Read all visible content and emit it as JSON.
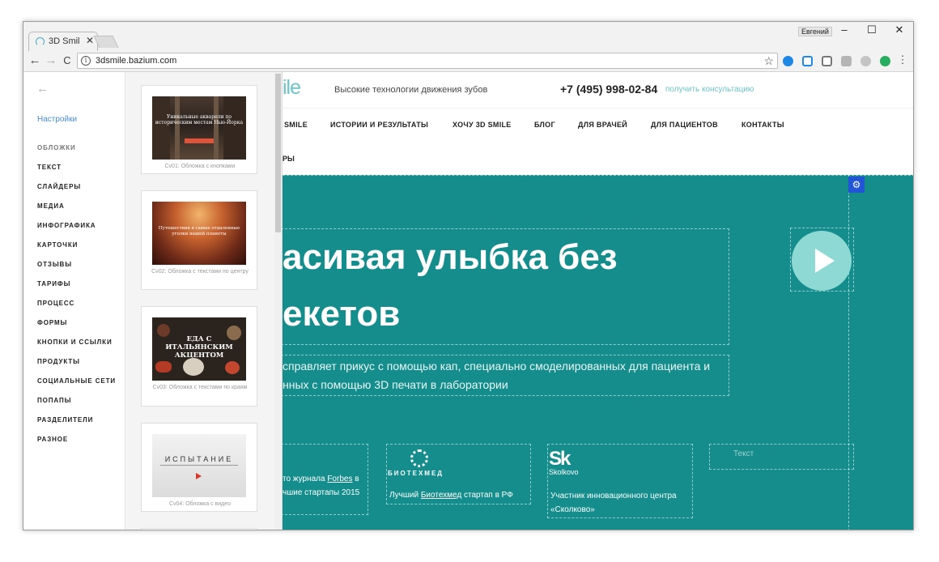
{
  "browser": {
    "tab_title": "3D Smil",
    "tab_close": "✕",
    "user_name": "Евгений",
    "controls": {
      "minimize": "–",
      "maximize": "☐",
      "close": "✕"
    },
    "nav": {
      "back": "←",
      "forward": "→",
      "reload": "C"
    },
    "url": "3dsmile.bazium.com",
    "info_glyph": "i",
    "star_glyph": "☆",
    "menu_glyph": "⋮",
    "extensions": [
      "#1e88e5",
      "#1e88e5",
      "#777777",
      "#9e9e9e",
      "#9e9e9e",
      "#27ae60"
    ]
  },
  "sidebar": {
    "back_arrow": "←",
    "settings": "Настройки",
    "categories": [
      "ОБЛОЖКИ",
      "ТЕКСТ",
      "СЛАЙДЕРЫ",
      "МЕДИА",
      "ИНФОГРАФИКА",
      "КАРТОЧКИ",
      "ОТЗЫВЫ",
      "ТАРИФЫ",
      "ПРОЦЕСС",
      "ФОРМЫ",
      "КНОПКИ И ССЫЛКИ",
      "ПРОДУКТЫ",
      "СОЦИАЛЬНЫЕ СЕТИ",
      "ПОПАПЫ",
      "РАЗДЕЛИТЕЛИ",
      "РАЗНОЕ"
    ]
  },
  "thumbnails": [
    {
      "caption": "Cv01: Обложка с кнопками",
      "image_text": "Уникальные акварели по историческим местам Нью-Йорка"
    },
    {
      "caption": "Cv02: Обложка с текстами по центру",
      "image_text": "Путешествия в самые отдаленные уголки нашей планеты"
    },
    {
      "caption": "Cv03: Обложка с текстами по краям",
      "image_text": "ЕДА С ИТАЛЬЯНСКИМ АКЦЕНТОМ"
    },
    {
      "caption": "Cv04: Обложка с видео",
      "image_text": "ИСПЫТАНИЕ"
    }
  ],
  "site": {
    "logo_fragment": "ile",
    "tagline": "Высокие технологии движения зубов",
    "phone": "+7 (495) 998-02-84",
    "consult_link": "получить консультацию",
    "menu": [
      "SMILE",
      "ИСТОРИИ И РЕЗУЛЬТАТЫ",
      "ХОЧУ 3D SMILE",
      "БЛОГ",
      "ДЛЯ ВРАЧЕЙ",
      "ДЛЯ ПАЦИЕНТОВ",
      "КОНТАКТЫ"
    ],
    "menu_row2": "РЫ",
    "hero": {
      "gear_glyph": "⚙",
      "title_line1": "асивая улыбка без",
      "title_line2": "екетов",
      "subtitle_line1": "справляет прикус с помощью кап, специально смоделированных для пациента и",
      "subtitle_line2": "нных с помощью 3D печати в лаборатории"
    },
    "partners": [
      {
        "line1_pre": "то  журнала ",
        "line1_link": "Forbes",
        "line1_post": " в",
        "line2": "чшие стартапы 2015"
      },
      {
        "name": "БИОТЕХМЕД",
        "line1_pre": "Лучший ",
        "line1_link": "Биотехмед",
        "line1_post": " стартап в РФ"
      },
      {
        "logo": "Sk",
        "name": "Skolkovo",
        "line1": "Участник инновационного центра",
        "line2": "«Сколково»"
      },
      {
        "placeholder": "Текст"
      }
    ]
  }
}
